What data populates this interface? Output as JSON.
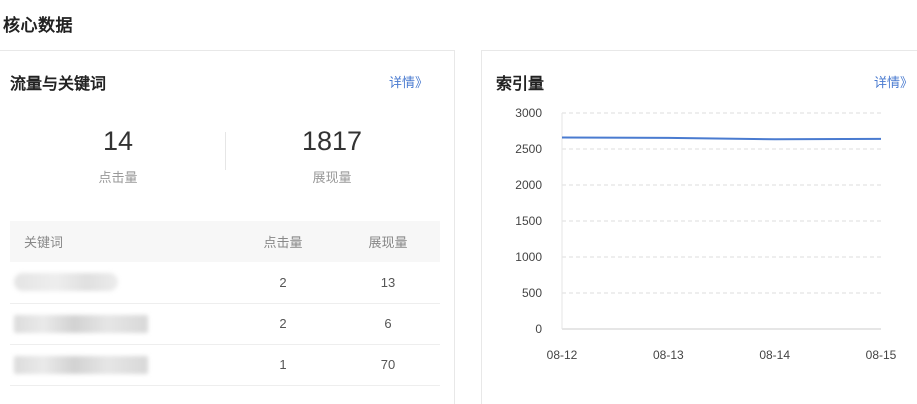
{
  "page": {
    "section_title": "核心数据"
  },
  "traffic": {
    "title": "流量与关键词",
    "detail": "详情》",
    "clicks": {
      "value": "14",
      "label": "点击量"
    },
    "impressions": {
      "value": "1817",
      "label": "展现量"
    },
    "table": {
      "headers": [
        "关键词",
        "点击量",
        "展现量"
      ],
      "rows": [
        {
          "keyword": "",
          "clicks": "2",
          "impressions": "13"
        },
        {
          "keyword": "",
          "clicks": "2",
          "impressions": "6"
        },
        {
          "keyword": "",
          "clicks": "1",
          "impressions": "70"
        }
      ]
    }
  },
  "index": {
    "title": "索引量",
    "detail": "详情》"
  },
  "chart_data": {
    "type": "line",
    "title": "",
    "xlabel": "",
    "ylabel": "",
    "x": [
      "08-12",
      "08-13",
      "08-14",
      "08-15"
    ],
    "series": [
      {
        "values": [
          2660,
          2655,
          2635,
          2640
        ],
        "color": "#4a7bd0"
      }
    ],
    "ylim": [
      0,
      3000
    ],
    "yticks": [
      0,
      500,
      1000,
      1500,
      2000,
      2500,
      3000
    ],
    "grid": true,
    "legend": "none"
  }
}
